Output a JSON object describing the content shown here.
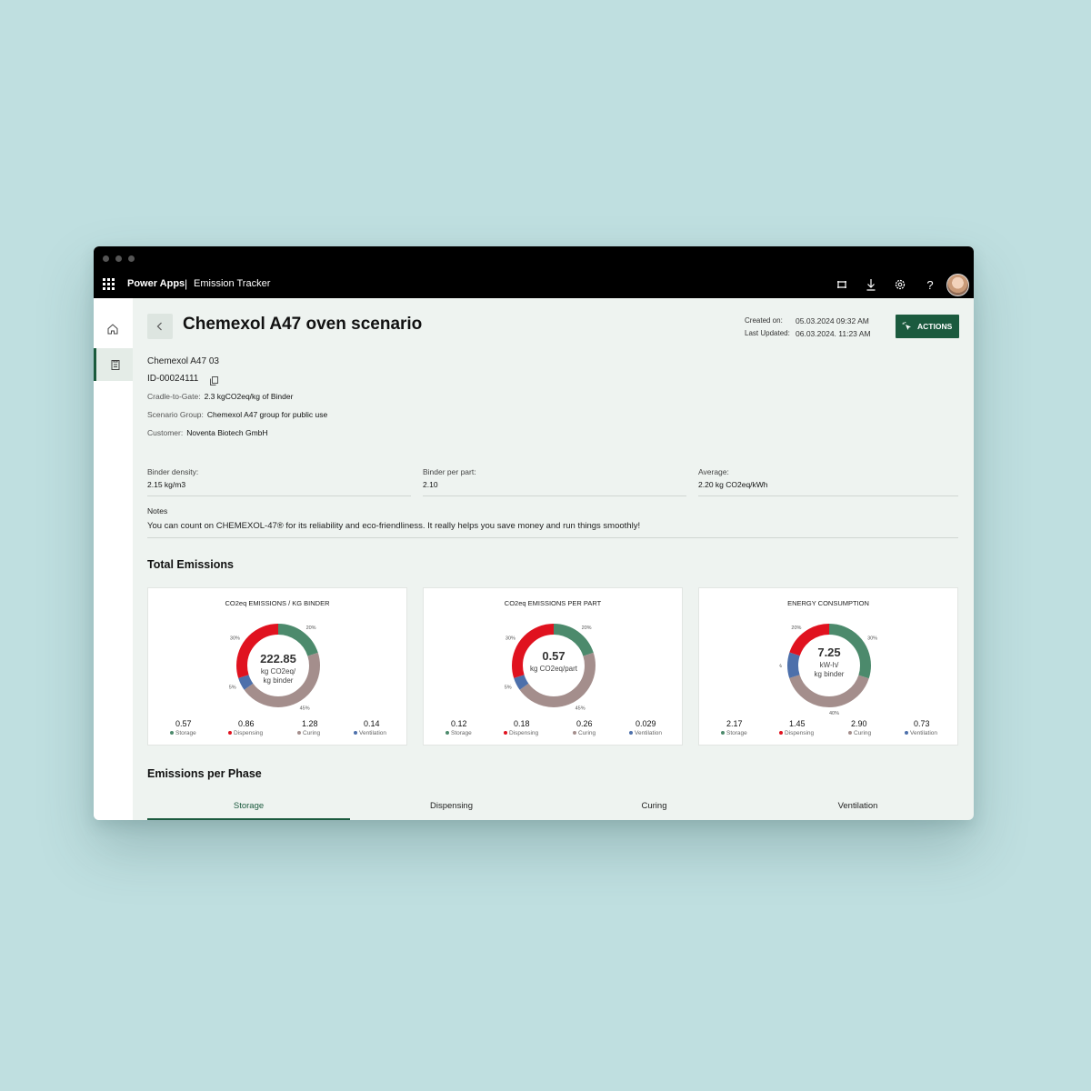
{
  "app": {
    "brand": "Power Apps",
    "separator": "|",
    "name": "Emission Tracker"
  },
  "header": {
    "title": "Chemexol A47 oven scenario",
    "created_label": "Created on:",
    "created_value": "05.03.2024 09:32 AM",
    "updated_label": "Last Updated:",
    "updated_value": "06.03.2024. 11:23 AM",
    "actions_label": "ACTIONS"
  },
  "record": {
    "name": "Chemexol A47 03",
    "id": "ID-00024111",
    "fields": [
      {
        "label": "Cradle-to-Gate:",
        "value": "2.3 kgCO2eq/kg of Binder"
      },
      {
        "label": "Scenario Group:",
        "value": "Chemexol A47 group for public use"
      },
      {
        "label": "Customer:",
        "value": "Noventa Biotech GmbH"
      }
    ]
  },
  "properties": [
    {
      "label": "Binder density:",
      "value": "2.15 kg/m3"
    },
    {
      "label": "Binder per part:",
      "value": "2.10"
    },
    {
      "label": "Average:",
      "value": "2.20 kg CO2eq/kWh"
    }
  ],
  "notes": {
    "label": "Notes",
    "value": "You can count on CHEMEXOL-47® for its reliability and eco-friendliness. It really helps you save money and run things smoothly!"
  },
  "total_emissions": {
    "title": "Total Emissions"
  },
  "colors": {
    "storage": "#4c8a6c",
    "dispensing": "#e0121f",
    "curing": "#a48e8c",
    "ventilation": "#4d70ab",
    "accent": "#1b5a3e"
  },
  "chart_data": [
    {
      "type": "pie",
      "title": "CO2eq EMISSIONS / KG BINDER",
      "center_value": "222.85",
      "center_unit": [
        "kg CO2eq/",
        "kg binder"
      ],
      "categories": [
        "Storage",
        "Curing",
        "Ventilation",
        "Dispensing"
      ],
      "percent_labels": [
        "20%",
        "45%",
        "5%",
        "30%"
      ],
      "values": [
        20,
        45,
        5,
        30
      ],
      "legend": [
        {
          "name": "Storage",
          "value": "0.57"
        },
        {
          "name": "Dispensing",
          "value": "0.86"
        },
        {
          "name": "Curing",
          "value": "1.28"
        },
        {
          "name": "Ventilation",
          "value": "0.14"
        }
      ]
    },
    {
      "type": "pie",
      "title": "CO2eq EMISSIONS PER PART",
      "center_value": "0.57",
      "center_unit": [
        "kg CO2eq/part"
      ],
      "categories": [
        "Storage",
        "Curing",
        "Ventilation",
        "Dispensing"
      ],
      "percent_labels": [
        "20%",
        "45%",
        "5%",
        "30%"
      ],
      "values": [
        20,
        45,
        5,
        30
      ],
      "legend": [
        {
          "name": "Storage",
          "value": "0.12"
        },
        {
          "name": "Dispensing",
          "value": "0.18"
        },
        {
          "name": "Curing",
          "value": "0.26"
        },
        {
          "name": "Ventilation",
          "value": "0.029"
        }
      ]
    },
    {
      "type": "pie",
      "title": "ENERGY CONSUMPTION",
      "center_value": "7.25",
      "center_unit": [
        "kW-h/",
        "kg binder"
      ],
      "categories": [
        "Storage",
        "Curing",
        "Ventilation",
        "Dispensing"
      ],
      "percent_labels": [
        "30%",
        "40%",
        "10%",
        "20%"
      ],
      "values": [
        30,
        40,
        10,
        20
      ],
      "legend": [
        {
          "name": "Storage",
          "value": "2.17"
        },
        {
          "name": "Dispensing",
          "value": "1.45"
        },
        {
          "name": "Curing",
          "value": "2.90"
        },
        {
          "name": "Ventilation",
          "value": "0.73"
        }
      ]
    }
  ],
  "phases": {
    "title": "Emissions per Phase",
    "tabs": [
      "Storage",
      "Dispensing",
      "Curing",
      "Ventilation"
    ],
    "selected": "Storage"
  }
}
